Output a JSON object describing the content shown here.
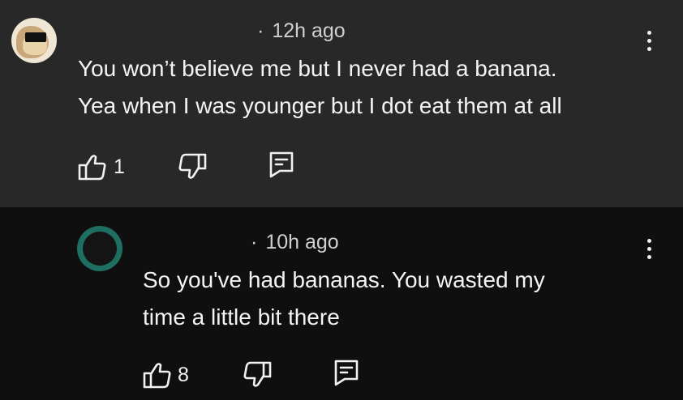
{
  "comments": [
    {
      "timestamp": "12h ago",
      "lines": [
        "You won’t believe me but I never had a banana.",
        "Yea when I was younger but I dot eat them at all"
      ],
      "likes": "1"
    },
    {
      "timestamp": "10h ago",
      "lines": [
        "So you've had bananas. You wasted my",
        "time a little bit there"
      ],
      "likes": "8"
    }
  ],
  "icons": {
    "like": "thumbs-up-icon",
    "dislike": "thumbs-down-icon",
    "reply": "reply-icon",
    "more": "more-vertical-icon"
  },
  "colors": {
    "top_background": "#282828",
    "reply_background": "#0f0f0f",
    "reply_avatar_ring": "#1e6e62"
  }
}
